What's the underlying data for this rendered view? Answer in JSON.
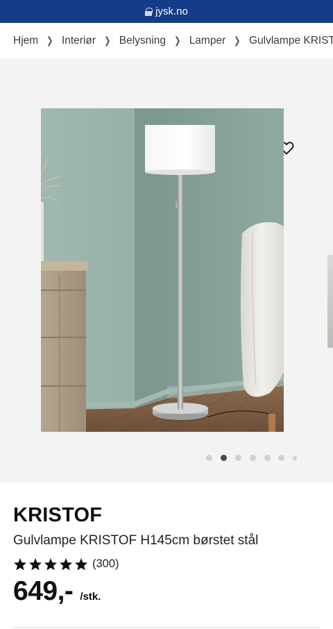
{
  "browser": {
    "url": "jysk.no"
  },
  "breadcrumb": {
    "items": [
      {
        "label": "Hjem"
      },
      {
        "label": "Interiør"
      },
      {
        "label": "Belysning"
      },
      {
        "label": "Lamper"
      },
      {
        "label": "Gulvlampe KRISTOF"
      }
    ]
  },
  "gallery": {
    "image_count": 7,
    "active_index": 1
  },
  "product": {
    "brand": "KRISTOF",
    "name": "Gulvlampe KRISTOF H145cm børstet stål",
    "rating": 5,
    "reviews": "(300)",
    "price": "649,-",
    "unit": "/stk."
  },
  "colors": {
    "header": "#143c8a",
    "gallery_bg": "#f3f3f3",
    "dot_active": "#4a4a4a",
    "dot_inactive": "#d0d0d0"
  }
}
